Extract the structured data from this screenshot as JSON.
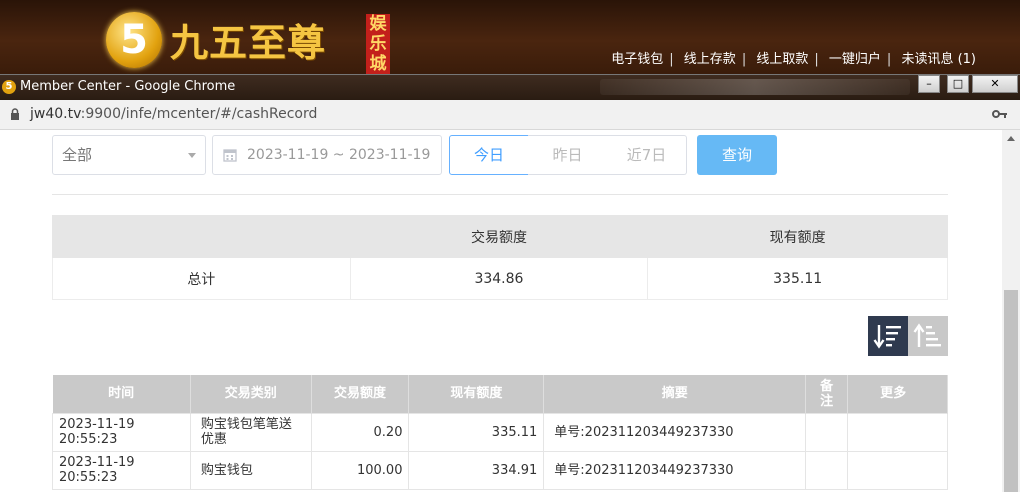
{
  "site": {
    "logo_text": "九五至尊",
    "logo_subtitle": "娱乐城",
    "logo_digit": "5",
    "nav": [
      "电子钱包",
      "线上存款",
      "线上取款",
      "一键归户",
      "未读讯息 (1)"
    ]
  },
  "window": {
    "title": "Member Center - Google Chrome",
    "controls": [
      "minimize-icon",
      "maximize-icon",
      "close-icon"
    ]
  },
  "addressbar": {
    "host": "jw40.tv",
    "path": ":9900/infe/mcenter/#/cashRecord"
  },
  "filters": {
    "type_select": "全部",
    "date_range": "2023-11-19 ~ 2023-11-19",
    "quick_buttons": [
      "今日",
      "昨日",
      "近7日"
    ],
    "active_quick": "今日",
    "query_label": "查询"
  },
  "summary": {
    "headers": [
      "",
      "交易额度",
      "现有额度"
    ],
    "row_label": "总计",
    "trade_total": "334.86",
    "balance_total": "335.11"
  },
  "records": {
    "headers": [
      "时间",
      "交易类别",
      "交易额度",
      "现有额度",
      "摘要",
      "备注",
      "更多"
    ],
    "rows": [
      {
        "time": "2023-11-19 20:55:23",
        "type": "购宝钱包笔笔送优惠",
        "amount": "0.20",
        "balance": "335.11",
        "memo": "单号:202311203449237330",
        "note": "",
        "more": ""
      },
      {
        "time": "2023-11-19 20:55:23",
        "type": "购宝钱包",
        "amount": "100.00",
        "balance": "334.91",
        "memo": "单号:202311203449237330",
        "note": "",
        "more": ""
      }
    ]
  },
  "colors": {
    "accent": "#409eff",
    "query_button": "#66b9f5",
    "sort_active": "#2f3a4f",
    "table_header": "#c9c9c9"
  }
}
